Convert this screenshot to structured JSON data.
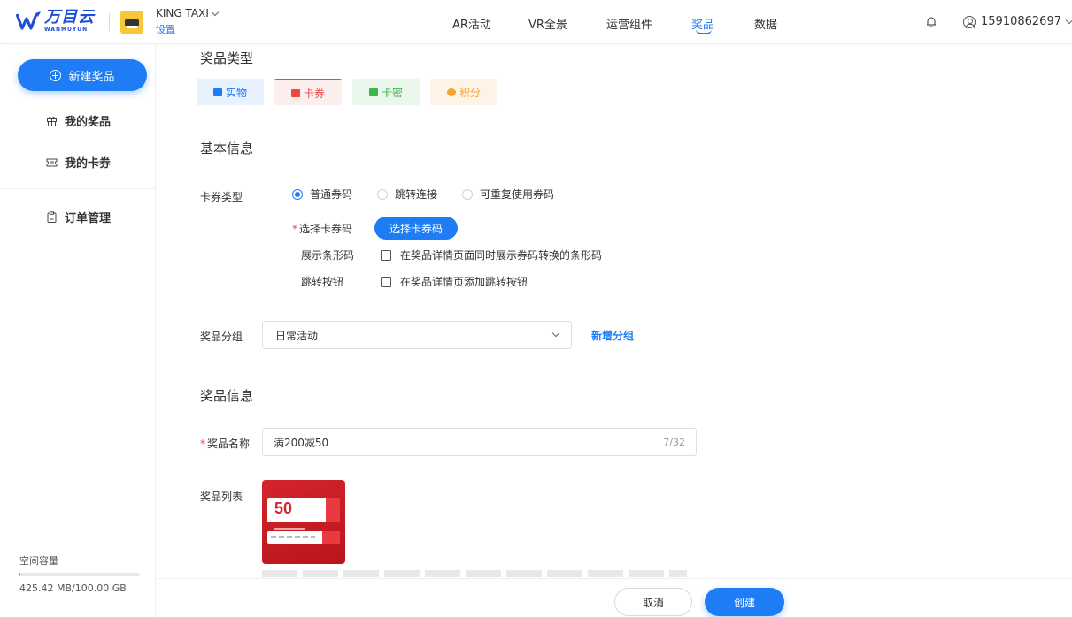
{
  "header": {
    "logo_cn": "万目云",
    "logo_en": "WANMUYUN",
    "brand_name": "KING TAXI",
    "brand_setting": "设置",
    "nav": [
      {
        "label": "AR活动",
        "active": false
      },
      {
        "label": "VR全景",
        "active": false
      },
      {
        "label": "运营组件",
        "active": false
      },
      {
        "label": "奖品",
        "active": true
      },
      {
        "label": "数据",
        "active": false
      }
    ],
    "user_phone": "15910862697"
  },
  "sidebar": {
    "new_button": "新建奖品",
    "items": [
      {
        "label": "我的奖品",
        "icon": "gift-icon"
      },
      {
        "label": "我的卡券",
        "icon": "ticket-icon"
      },
      {
        "label": "订单管理",
        "icon": "clipboard-icon"
      }
    ],
    "storage_label": "空间容量",
    "storage_value": "425.42 MB/100.00 GB",
    "storage_used_fraction": 0.004
  },
  "main": {
    "section_type_title": "奖品类型",
    "types": [
      {
        "label": "实物",
        "color": "#1e7cf5",
        "bg": "#e8f2fe",
        "selected": false
      },
      {
        "label": "卡券",
        "color": "#f04545",
        "bg": "#fdeeee",
        "selected": true
      },
      {
        "label": "卡密",
        "color": "#3fb54a",
        "bg": "#eaf7ec",
        "selected": false
      },
      {
        "label": "积分",
        "color": "#f3a53a",
        "bg": "#fdf3e6",
        "selected": false
      }
    ],
    "section_basic_title": "基本信息",
    "coupon_type_label": "卡券类型",
    "coupon_options": [
      {
        "label": "普通券码",
        "checked": true
      },
      {
        "label": "跳转连接",
        "checked": false
      },
      {
        "label": "可重复使用券码",
        "checked": false
      }
    ],
    "select_code_label": "选择卡券码",
    "select_code_button": "选择卡券码",
    "barcode_label": "展示条形码",
    "barcode_text": "在奖品详情页面同时展示券码转换的条形码",
    "jump_label": "跳转按钮",
    "jump_text": "在奖品详情页添加跳转按钮",
    "group_label": "奖品分组",
    "group_value": "日常活动",
    "group_add_link": "新增分组",
    "section_prize_title": "奖品信息",
    "name_label": "奖品名称",
    "name_value": "满200减50",
    "name_count": "7/32",
    "list_label": "奖品列表",
    "coupon_image_value": "50"
  },
  "footer": {
    "cancel": "取消",
    "create": "创建"
  }
}
